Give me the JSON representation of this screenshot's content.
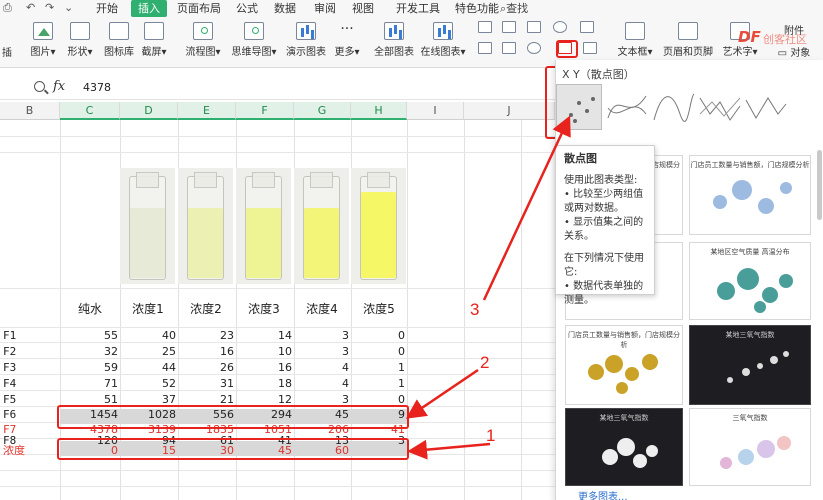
{
  "menubar": {
    "items": [
      "开始",
      "插入",
      "页面布局",
      "公式",
      "数据",
      "审阅",
      "视图",
      "开发工具",
      "特色功能"
    ],
    "active": "插入",
    "search": "查找"
  },
  "ribbon": {
    "buttons": [
      "图片",
      "形状",
      "图标库",
      "截屏",
      "流程图",
      "思维导图",
      "演示图表",
      "更多",
      "全部图表",
      "在线图表",
      "文本框",
      "页眉和页脚",
      "艺术字",
      "对象"
    ],
    "partial_left": "插",
    "right_label": "附件",
    "badge": "DF",
    "badge_sub": "创客社区"
  },
  "formula_bar": {
    "fx": "fx",
    "value": "4378"
  },
  "columns": [
    "B",
    "C",
    "D",
    "E",
    "F",
    "G",
    "H",
    "I",
    "J"
  ],
  "selected_columns": [
    "C",
    "D",
    "E",
    "F",
    "G",
    "H"
  ],
  "table": {
    "headers": [
      "纯水",
      "浓度1",
      "浓度2",
      "浓度3",
      "浓度4",
      "浓度5"
    ],
    "rows": [
      {
        "label": "F1",
        "values": [
          "55",
          "40",
          "23",
          "14",
          "3",
          "0"
        ],
        "style": "normal"
      },
      {
        "label": "F2",
        "values": [
          "32",
          "25",
          "16",
          "10",
          "3",
          "0"
        ],
        "style": "normal"
      },
      {
        "label": "F3",
        "values": [
          "59",
          "44",
          "26",
          "16",
          "4",
          "1"
        ],
        "style": "normal"
      },
      {
        "label": "F4",
        "values": [
          "71",
          "52",
          "31",
          "18",
          "4",
          "1"
        ],
        "style": "normal"
      },
      {
        "label": "F5",
        "values": [
          "51",
          "37",
          "21",
          "12",
          "3",
          "0"
        ],
        "style": "normal"
      },
      {
        "label": "F6",
        "values": [
          "1454",
          "1028",
          "556",
          "294",
          "45",
          "9"
        ],
        "style": "normal"
      },
      {
        "label": "F7",
        "values": [
          "4378",
          "3139",
          "1835",
          "1051",
          "206",
          "41"
        ],
        "style": "red"
      },
      {
        "label": "F8",
        "values": [
          "120",
          "94",
          "61",
          "41",
          "13",
          "3"
        ],
        "style": "normal"
      },
      {
        "label": "浓度",
        "values": [
          "0",
          "15",
          "30",
          "45",
          "60",
          ""
        ],
        "style": "red"
      }
    ]
  },
  "annotations": [
    "1",
    "2",
    "3"
  ],
  "chart_panel": {
    "section_title": "X Y（散点图）",
    "faded_label": "布局",
    "tooltip": {
      "title": "散点图",
      "lines": [
        "使用此图表类型:",
        "• 比较至少两组值或两对数据。",
        "• 显示值集之间的关系。",
        "",
        "在下列情况下使用它:",
        "• 数据代表单独的测量。"
      ]
    },
    "gallery": [
      "门店员工数量与销售额，门店规模分析",
      "门店员工数量与销售额，门店规模分析",
      "某地区空气质量 高温分布",
      "门店员工数量与销售额，门店规模分析",
      "某地三氧气指数",
      "某地三氧气指数",
      "三氧气指数"
    ],
    "more_link": "更多图表..."
  },
  "colors": {
    "accent": "#2fb070",
    "annotation": "#e8221c"
  }
}
